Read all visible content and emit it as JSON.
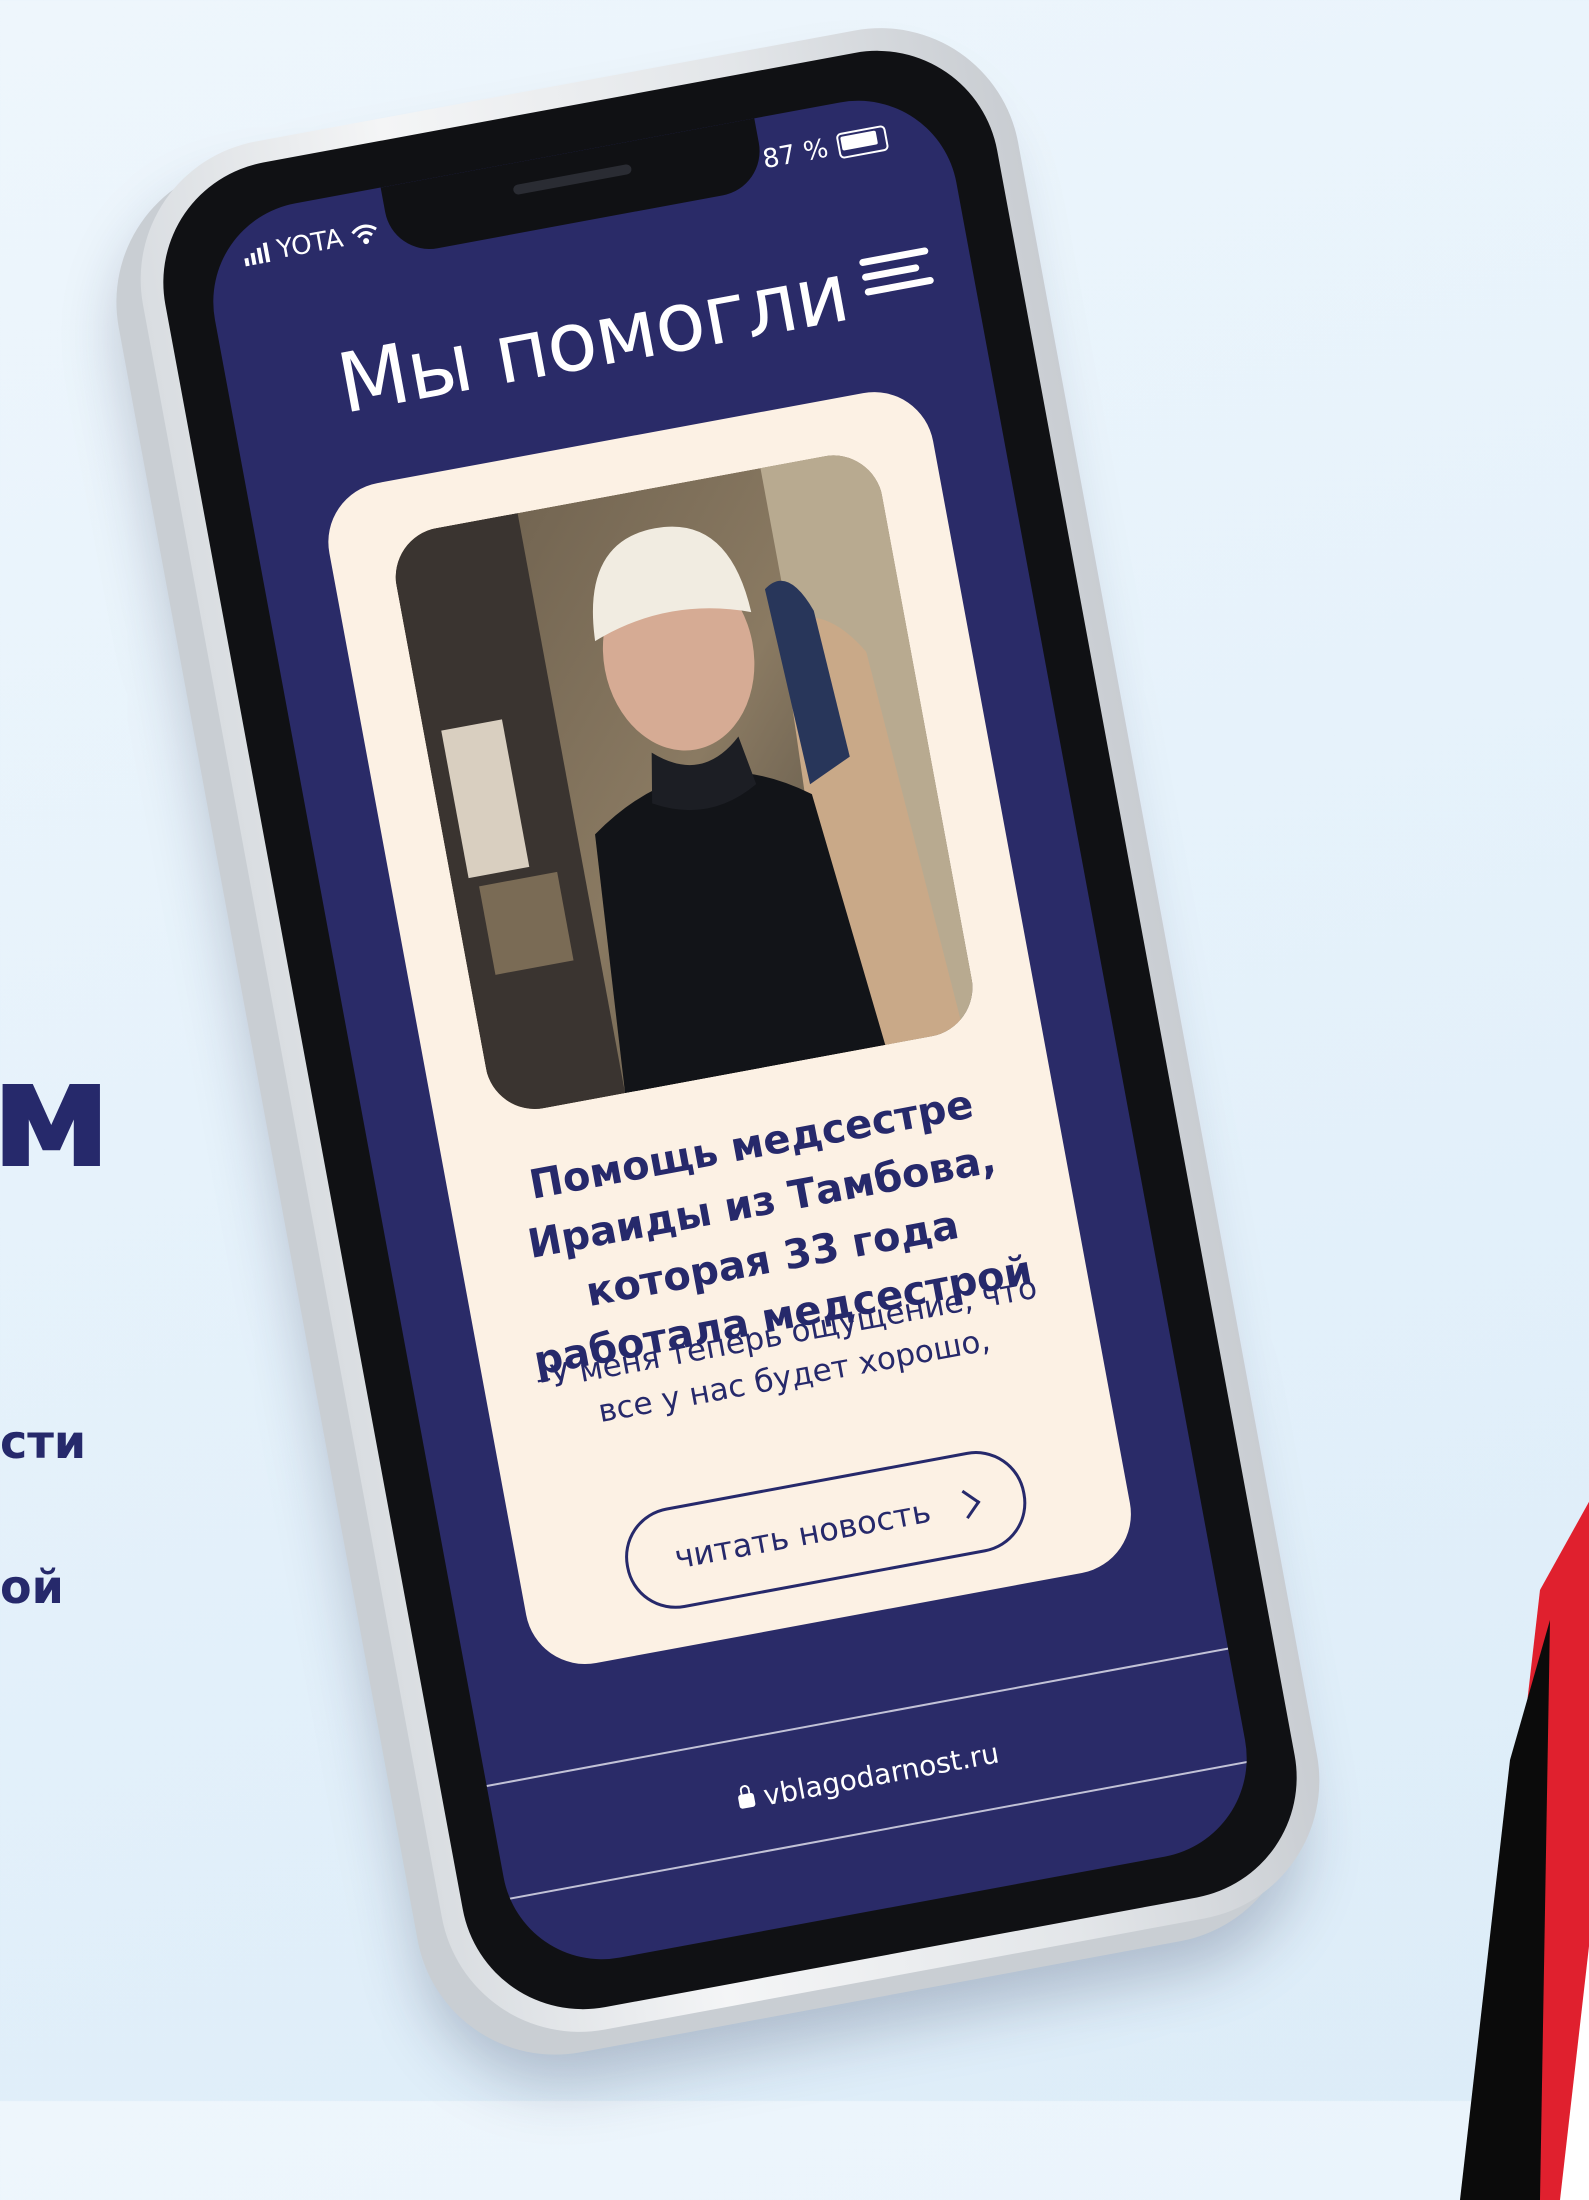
{
  "background_fragments": {
    "big": "м",
    "line1": "сти",
    "line2": "ой"
  },
  "status_bar": {
    "carrier": "YOTA",
    "battery": "87 %"
  },
  "header": {
    "title": "Мы помогли"
  },
  "news_card": {
    "title": "Помощь медсестре Ираиды из Тамбова, которая 33 года работала медсестрой",
    "quote": "–У меня теперь ощущение, что все у нас будет хорошо,",
    "read_button": "читать новость"
  },
  "browser": {
    "url": "vblagodarnost.ru"
  },
  "colors": {
    "screen_bg": "#2a2b68",
    "card_bg": "#fcf1e4",
    "text_dark": "#26296b",
    "stripe_red": "#e0202e"
  }
}
